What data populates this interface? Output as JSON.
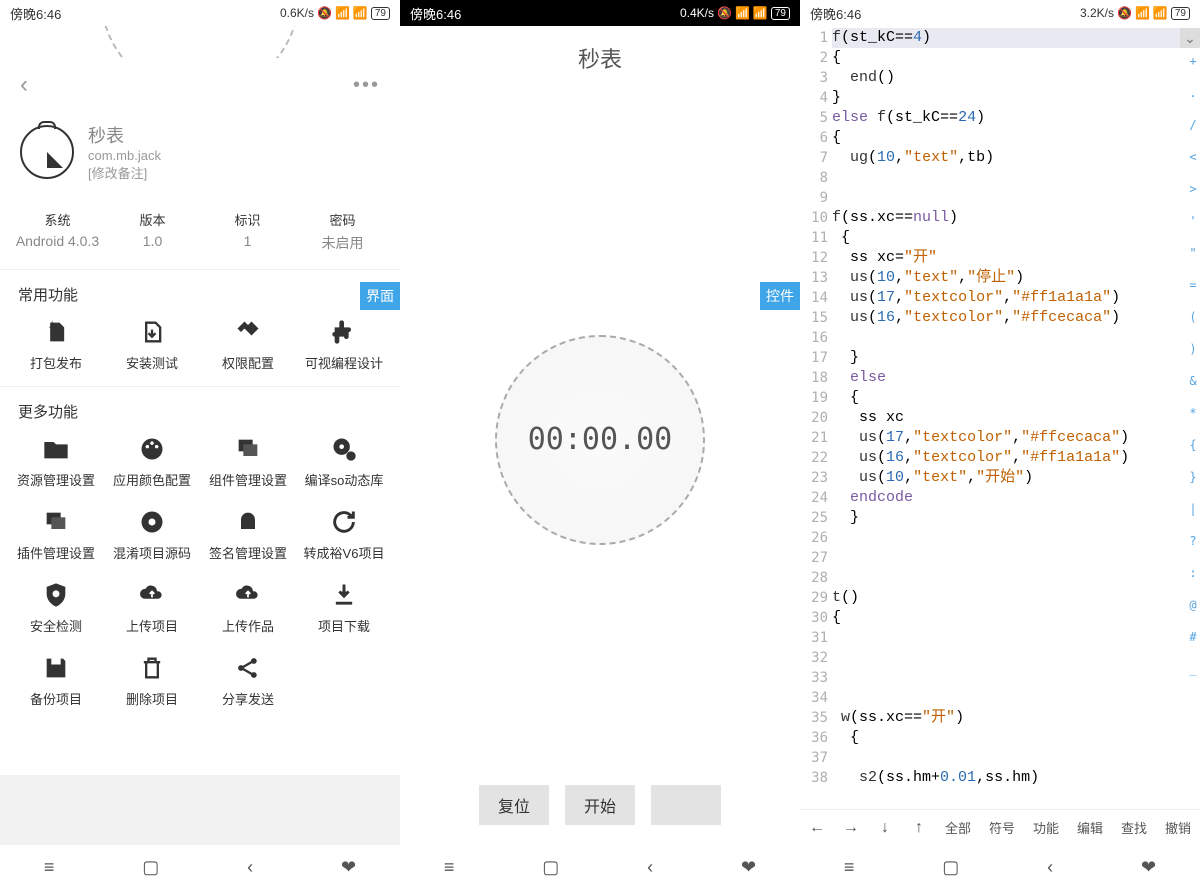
{
  "screen1": {
    "status": {
      "time": "傍晚6:46",
      "net": "0.6K/s",
      "battery": "79"
    },
    "app": {
      "name": "秒表",
      "pkg": "com.mb.jack",
      "remark": "[修改备注]"
    },
    "props": {
      "system_label": "系统",
      "system_value": "Android 4.0.3",
      "version_label": "版本",
      "version_value": "1.0",
      "flag_label": "标识",
      "flag_value": "1",
      "password_label": "密码",
      "password_value": "未启用"
    },
    "section1": "常用功能",
    "common": [
      "打包发布",
      "安装测试",
      "权限配置",
      "可视编程设计"
    ],
    "section2": "更多功能",
    "more": [
      "资源管理设置",
      "应用颜色配置",
      "组件管理设置",
      "编译so动态库",
      "插件管理设置",
      "混淆项目源码",
      "签名管理设置",
      "转成裕V6项目",
      "安全检测",
      "上传项目",
      "上传作品",
      "项目下载",
      "备份项目",
      "删除项目",
      "分享发送"
    ],
    "float_tab": "界面"
  },
  "screen2": {
    "status": {
      "time": "傍晚6:46",
      "net": "0.4K/s",
      "battery": "79"
    },
    "title": "秒表",
    "time": "00:00.00",
    "buttons": {
      "reset": "复位",
      "start": "开始",
      "lap": ""
    },
    "float_tab": "控件"
  },
  "screen3": {
    "status": {
      "time": "傍晚6:46",
      "net": "3.2K/s",
      "battery": "79"
    },
    "code_lines": [
      "f(st_kC==4)",
      "{",
      "  end()",
      "}",
      "else f(st_kC==24)",
      "{",
      "  ug(10,\"text\",tb)",
      "",
      "",
      "f(ss.xc==null)",
      " {",
      "  ss xc=\"开\"",
      "  us(10,\"text\",\"停止\")",
      "  us(17,\"textcolor\",\"#ff1a1a1a\")",
      "  us(16,\"textcolor\",\"#ffcecaca\")",
      "",
      "  }",
      "  else",
      "  {",
      "   ss xc",
      "   us(17,\"textcolor\",\"#ffcecaca\")",
      "   us(16,\"textcolor\",\"#ff1a1a1a\")",
      "   us(10,\"text\",\"开始\")",
      "  endcode",
      "  }",
      "",
      "",
      "",
      "t()",
      "{",
      "",
      "",
      "",
      "",
      " w(ss.xc==\"开\")",
      "  {",
      "",
      "   s2(ss.hm+0.01,ss.hm)"
    ],
    "symbols": [
      "+",
      ".",
      "/",
      "<",
      ">",
      "'",
      "\"",
      "=",
      "(",
      ")",
      "&",
      "*",
      "{",
      "}",
      "|",
      "?",
      ":",
      "@",
      "#",
      "_"
    ],
    "toolbar": {
      "arrows": [
        "←",
        "→",
        "↓",
        "↑"
      ],
      "items": [
        "全部",
        "符号",
        "功能",
        "编辑",
        "查找",
        "撤销"
      ]
    }
  }
}
